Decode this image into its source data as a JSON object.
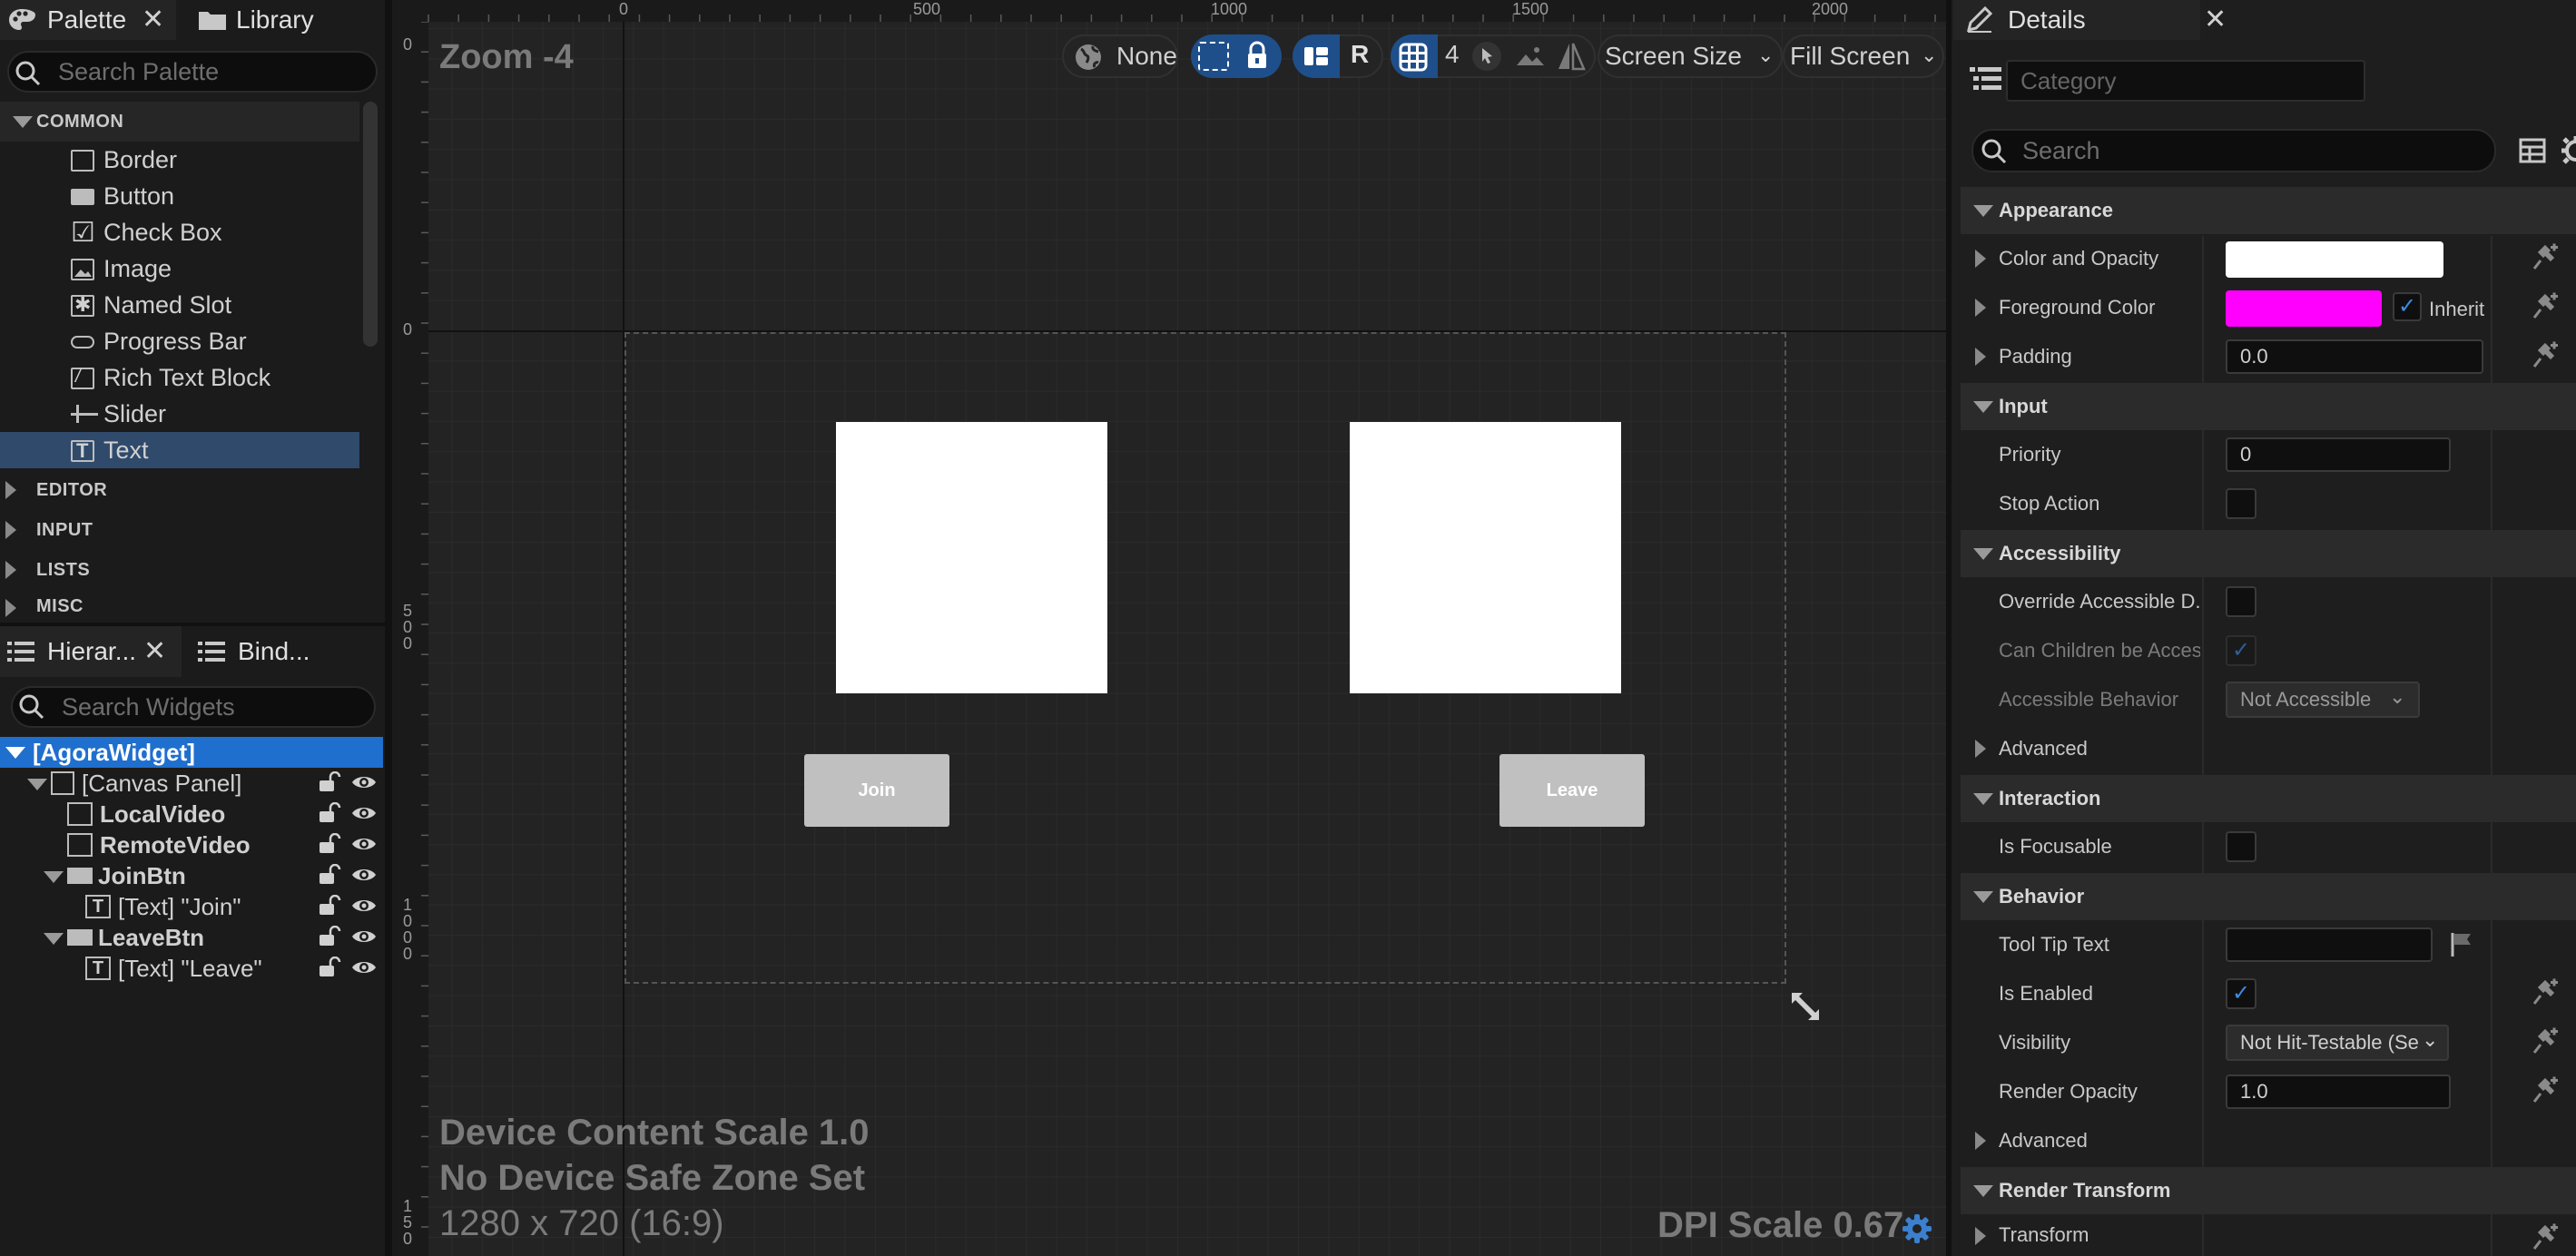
{
  "palette": {
    "tab_label": "Palette",
    "library_label": "Library",
    "search_placeholder": "Search Palette",
    "categories": {
      "common": "COMMON",
      "editor": "EDITOR",
      "input": "INPUT",
      "lists": "LISTS",
      "misc": "MISC"
    },
    "items": [
      "Border",
      "Button",
      "Check Box",
      "Image",
      "Named Slot",
      "Progress Bar",
      "Rich Text Block",
      "Slider",
      "Text"
    ],
    "selected_item": "Text"
  },
  "hierarchy": {
    "tab_label": "Hierar...",
    "bindings_label": "Bind...",
    "search_placeholder": "Search Widgets",
    "items": [
      "[AgoraWidget]",
      "[Canvas Panel]",
      "LocalVideo",
      "RemoteVideo",
      "JoinBtn",
      "[Text] \"Join\"",
      "LeaveBtn",
      "[Text] \"Leave\""
    ]
  },
  "designer": {
    "zoom": "Zoom -4",
    "ruler_top": [
      "0",
      "500",
      "1000",
      "1500",
      "2000"
    ],
    "ruler_left": [
      "0",
      "0",
      "5\n0\n0",
      "1\n0\n0\n0",
      "1\n5\n0"
    ],
    "toolbar": {
      "none_label": "None",
      "r_label": "R",
      "grid_size": "4",
      "screen_size": "Screen Size",
      "fill_screen": "Fill Screen"
    },
    "join_label": "Join",
    "leave_label": "Leave",
    "device_scale": "Device Content Scale 1.0",
    "safe_zone": "No Device Safe Zone Set",
    "resolution": "1280 x 720 (16:9)",
    "dpi_scale": "DPI Scale 0.67"
  },
  "details": {
    "tab_label": "Details",
    "category_placeholder": "Category",
    "search_placeholder": "Search",
    "sections": {
      "appearance": "Appearance",
      "input": "Input",
      "accessibility": "Accessibility",
      "interaction": "Interaction",
      "behavior": "Behavior",
      "render_transform": "Render Transform"
    },
    "rows": {
      "color_opacity": "Color and Opacity",
      "foreground": "Foreground Color",
      "inherit": "Inherit",
      "padding": "Padding",
      "padding_value": "0.0",
      "priority": "Priority",
      "priority_value": "0",
      "stop_action": "Stop Action",
      "override_accessible": "Override Accessible D...",
      "can_children": "Can Children be Acces...",
      "accessible_behavior": "Accessible Behavior",
      "accessible_behavior_value": "Not Accessible",
      "advanced": "Advanced",
      "is_focusable": "Is Focusable",
      "tooltip": "Tool Tip Text",
      "is_enabled": "Is Enabled",
      "visibility": "Visibility",
      "visibility_value": "Not Hit-Testable (Self Only)",
      "render_opacity": "Render Opacity",
      "render_opacity_value": "1.0",
      "advanced2": "Advanced",
      "transform": "Transform"
    },
    "colors": {
      "color_opacity": "#ffffff",
      "foreground": "#ff00ff",
      "accent": "#1f6fce"
    }
  }
}
